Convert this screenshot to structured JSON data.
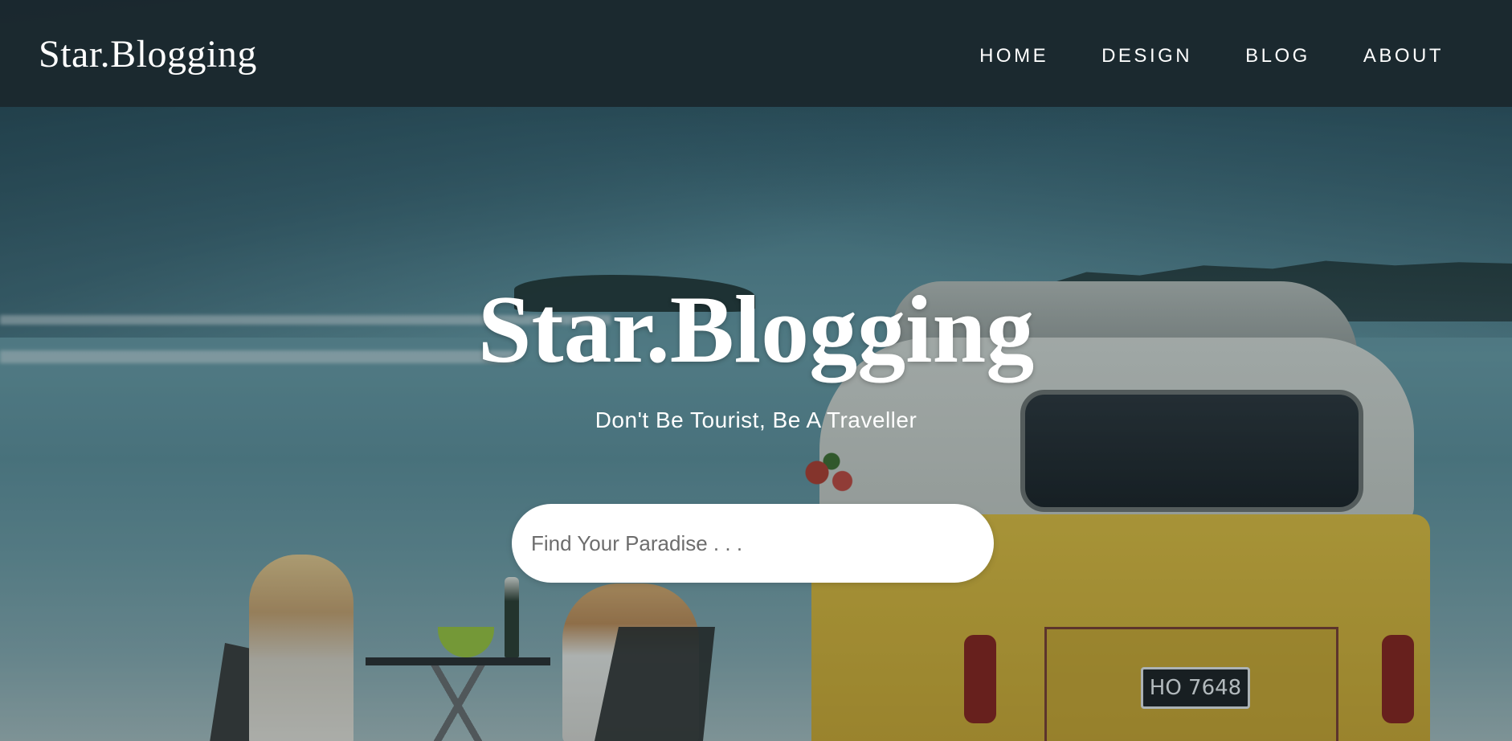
{
  "header": {
    "brand": "Star.Blogging",
    "nav": [
      {
        "label": "HOME"
      },
      {
        "label": "DESIGN"
      },
      {
        "label": "BLOG"
      },
      {
        "label": "ABOUT"
      }
    ]
  },
  "hero": {
    "title": "Star.Blogging",
    "tagline": "Don't Be Tourist, Be A Traveller",
    "search": {
      "placeholder": "Find Your Paradise . . .",
      "value": ""
    },
    "background": {
      "plate_text": "HO 7648"
    }
  },
  "colors": {
    "navbar_bg": "#1b282e",
    "text": "#ffffff",
    "search_bg": "#ffffff"
  }
}
